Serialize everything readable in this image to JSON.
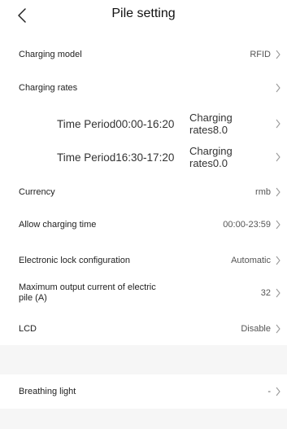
{
  "header": {
    "title": "Pile setting"
  },
  "rows": {
    "charging_model": {
      "label": "Charging model",
      "value": "RFID"
    },
    "charging_rates": {
      "label": "Charging rates"
    },
    "period1": {
      "period": "Time Period00:00-16:20",
      "rate": "Charging rates8.0"
    },
    "period2": {
      "period": "Time Period16:30-17:20",
      "rate": "Charging rates0.0"
    },
    "currency": {
      "label": "Currency",
      "value": "rmb"
    },
    "allow_time": {
      "label": "Allow charging time",
      "value": "00:00-23:59"
    },
    "lock": {
      "label": "Electronic lock configuration",
      "value": "Automatic"
    },
    "max_current": {
      "label": "Maximum output current of electric pile (A)",
      "value": "32"
    },
    "lcd": {
      "label": "LCD",
      "value": "Disable"
    },
    "breathing": {
      "label": "Breathing light",
      "value": "-"
    }
  },
  "icons": {
    "back": "chevron-left-icon",
    "chevron": "chevron-right-icon"
  }
}
